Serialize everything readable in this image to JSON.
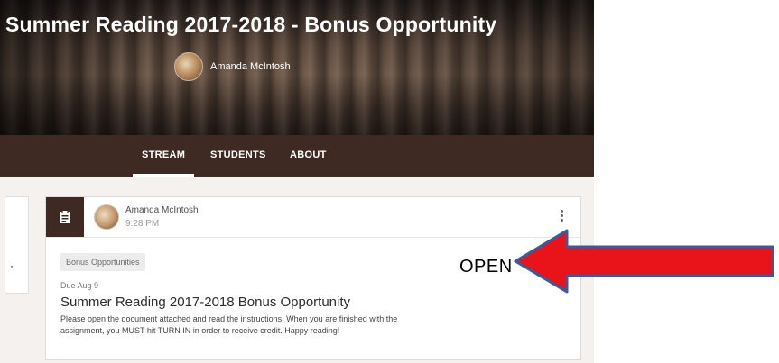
{
  "header": {
    "course_title": "Summer Reading 2017-2018 - Bonus Opportunity",
    "teacher_name": "Amanda McIntosh"
  },
  "nav": {
    "tabs": [
      {
        "label": "STREAM",
        "active": true
      },
      {
        "label": "STUDENTS",
        "active": false
      },
      {
        "label": "ABOUT",
        "active": false
      }
    ]
  },
  "post": {
    "author": "Amanda McIntosh",
    "time": "9:28 PM",
    "topic": "Bonus Opportunities",
    "due": "Due Aug 9",
    "title": "Summer Reading 2017-2018 Bonus Opportunity",
    "description": "Please open the document attached and read the instructions. When you are finished with the assignment, you MUST hit TURN IN in order to receive credit. Happy reading!"
  },
  "annotation": {
    "label": "OPEN",
    "arrow_color": "#e8141a",
    "arrow_outline": "#3a5a9a"
  },
  "colors": {
    "header_bg": "#3e2a22",
    "content_bg": "#f4f1ee"
  }
}
